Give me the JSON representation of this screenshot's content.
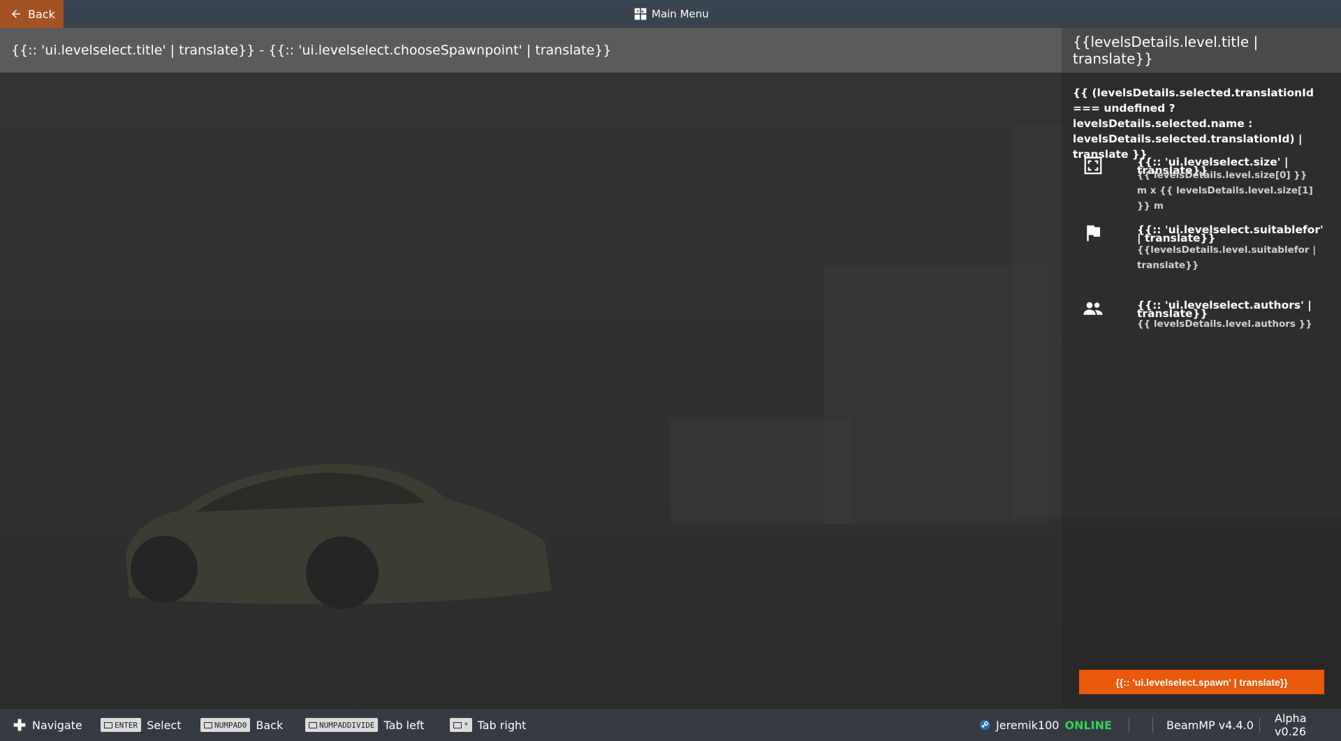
{
  "topbar": {
    "back_label": "Back",
    "main_menu_label": "Main Menu"
  },
  "header": {
    "left_title": "{{:: 'ui.levelselect.title' | translate}} - {{:: 'ui.levelselect.chooseSpawnpoint' | translate}}",
    "right_title": "{{levelsDetails.level.title | translate}}"
  },
  "panel": {
    "description": "{{ (levelsDetails.selected.translationId === undefined ? levelsDetails.selected.name : levelsDetails.selected.translationId) | translate }}",
    "size": {
      "icon": "fullscreen-icon",
      "title": "{{:: 'ui.levelselect.size' | translate}}",
      "value": "{{ levelsDetails.level.size[0] }} m x {{ levelsDetails.level.size[1] }} m"
    },
    "suitable": {
      "icon": "flag-icon",
      "title": "{{:: 'ui.levelselect.suitablefor' | translate}}",
      "value": "{{levelsDetails.level.suitablefor | translate}}"
    },
    "authors": {
      "icon": "people-icon",
      "title": "{{:: 'ui.levelselect.authors' | translate}}",
      "value": "{{ levelsDetails.level.authors }}"
    },
    "spawn_label": "{{:: 'ui.levelselect.spawn' | translate}}"
  },
  "bottombar": {
    "navigate": "Navigate",
    "select_key": "ENTER",
    "select": "Select",
    "back_key": "NUMPAD0",
    "back": "Back",
    "tableft_key": "NUMPADDIVIDE",
    "tableft": "Tab left",
    "tabright_key": "*",
    "tabright": "Tab right",
    "username": "Jeremik100",
    "status": "ONLINE",
    "mp_version": "BeamMP v4.4.0",
    "game_version": "Alpha v0.26"
  },
  "colors": {
    "accent": "#e8590c",
    "back_button": "#a25224",
    "online": "#35d35a"
  }
}
